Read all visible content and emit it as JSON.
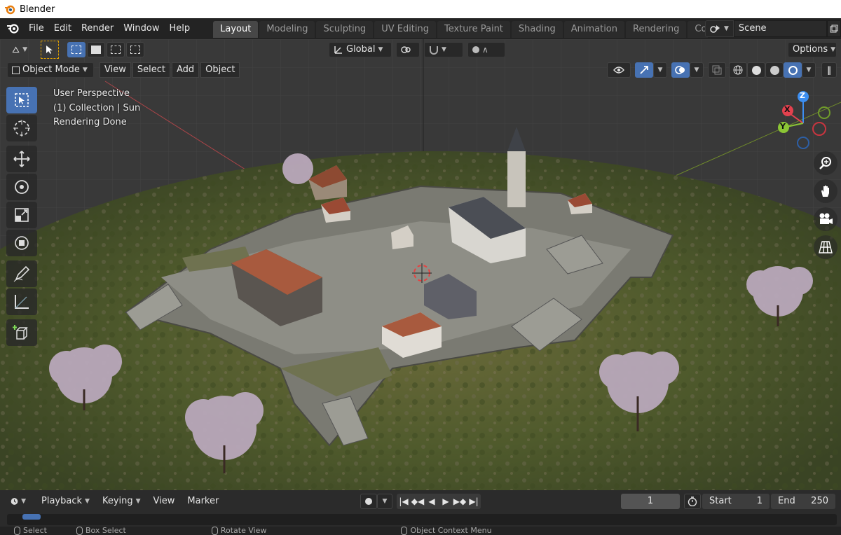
{
  "window_title": "Blender",
  "menu": [
    "File",
    "Edit",
    "Render",
    "Window",
    "Help"
  ],
  "workspaces": [
    {
      "label": "Layout",
      "active": true
    },
    {
      "label": "Modeling",
      "active": false
    },
    {
      "label": "Sculpting",
      "active": false
    },
    {
      "label": "UV Editing",
      "active": false
    },
    {
      "label": "Texture Paint",
      "active": false
    },
    {
      "label": "Shading",
      "active": false
    },
    {
      "label": "Animation",
      "active": false
    },
    {
      "label": "Rendering",
      "active": false
    },
    {
      "label": "Compos",
      "active": false
    }
  ],
  "scene_name": "Scene",
  "tool_header": {
    "orientation": "Global",
    "options_label": "Options"
  },
  "viewport_header": {
    "mode": "Object Mode",
    "menus": [
      "View",
      "Select",
      "Add",
      "Object"
    ]
  },
  "viewport_info": {
    "line1": "User Perspective",
    "line2": "(1) Collection | Sun",
    "line3": "Rendering Done"
  },
  "gizmo_axes": {
    "z": "Z",
    "x": "X",
    "y": "Y"
  },
  "timeline": {
    "menus": [
      "Playback",
      "Keying",
      "View",
      "Marker"
    ],
    "current_frame": "1",
    "start_label": "Start",
    "start_value": "1",
    "end_label": "End",
    "end_value": "250"
  },
  "status_bar": {
    "select": "Select",
    "box_select": "Box Select",
    "rotate_view": "Rotate View",
    "context_menu": "Object Context Menu"
  },
  "colors": {
    "accent": "#4772b3",
    "topbar": "#232323",
    "panel": "#2b2b2b",
    "axis_x": "#e3414e",
    "axis_y": "#8bc535",
    "axis_z": "#3c8ef0"
  }
}
